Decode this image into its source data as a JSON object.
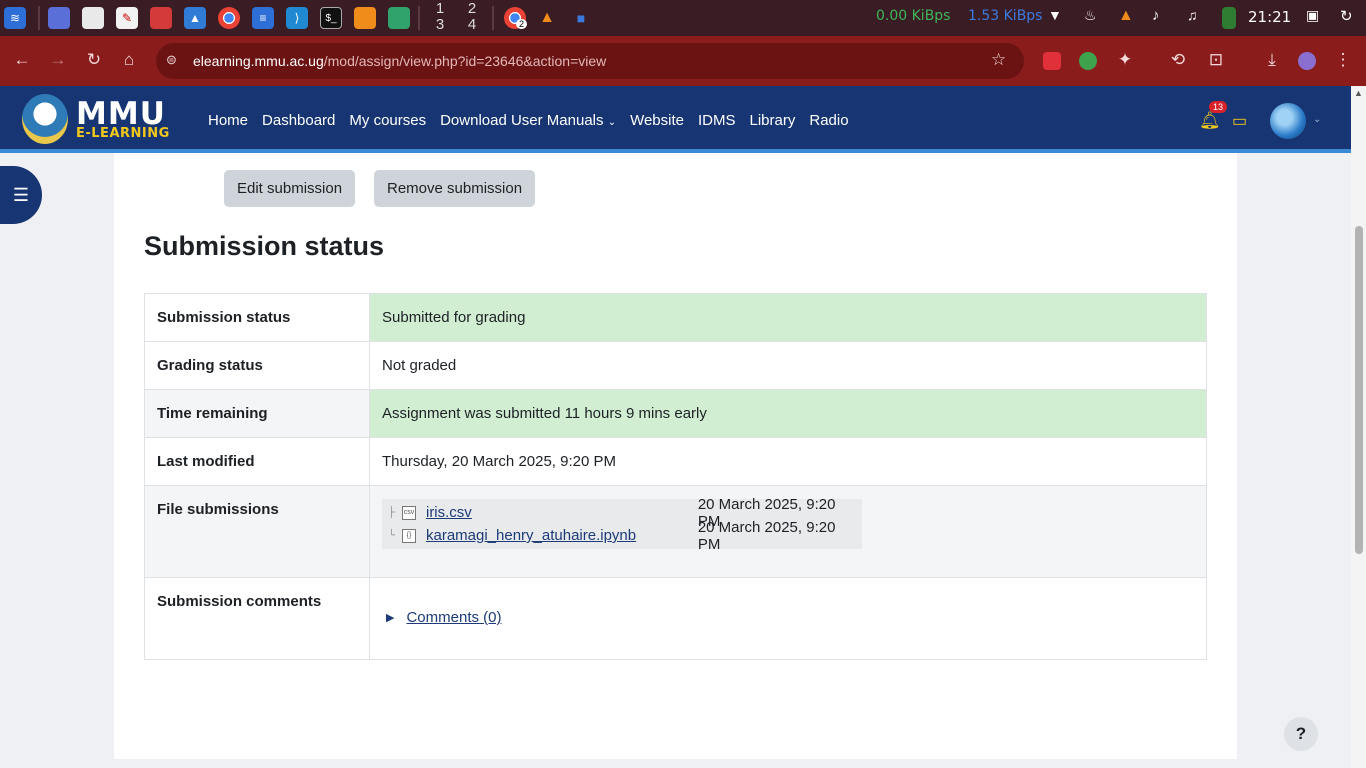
{
  "taskbar": {
    "workspaces": [
      [
        "1",
        "3"
      ],
      [
        "2",
        "4"
      ]
    ],
    "net_down": "0.00 KiBps",
    "net_up": "1.53 KiBps",
    "clock": "21:21",
    "window_badge": "2"
  },
  "browser": {
    "url_host": "elearning.mmu.ac.ug",
    "url_path": "/mod/assign/view.php?id=23646&action=view"
  },
  "site": {
    "logo_text": "MMU",
    "logo_subtext": "E-LEARNING",
    "menu": [
      "Home",
      "Dashboard",
      "My courses",
      "Download User Manuals",
      "Website",
      "IDMS",
      "Library",
      "Radio"
    ],
    "notification_count": "13"
  },
  "actions": {
    "edit": "Edit submission",
    "remove": "Remove submission"
  },
  "section_title": "Submission status",
  "status_table": {
    "submission_status": {
      "label": "Submission status",
      "value": "Submitted for grading"
    },
    "grading_status": {
      "label": "Grading status",
      "value": "Not graded"
    },
    "time_remaining": {
      "label": "Time remaining",
      "value": "Assignment was submitted 11 hours 9 mins early"
    },
    "last_modified": {
      "label": "Last modified",
      "value": "Thursday, 20 March 2025, 9:20 PM"
    },
    "file_submissions": {
      "label": "File submissions",
      "files": [
        {
          "name": "iris.csv",
          "date": "20 March 2025, 9:20 PM"
        },
        {
          "name": "karamagi_henry_atuhaire.ipynb",
          "date": "20 March 2025, 9:20 PM"
        }
      ]
    },
    "submission_comments": {
      "label": "Submission comments",
      "link": "Comments (0)"
    }
  },
  "help_label": "?",
  "colors": {
    "navbar": "#173572",
    "accent_yellow": "#f2c81c",
    "success_bg": "#d1eed3",
    "browser_chrome": "#8a1c1c"
  }
}
